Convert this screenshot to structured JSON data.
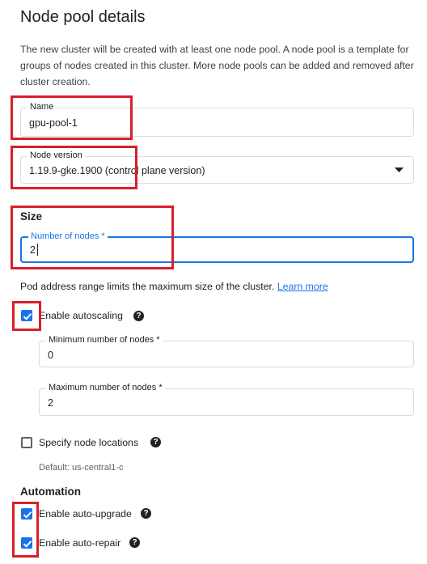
{
  "title": "Node pool details",
  "description": "The new cluster will be created with at least one node pool. A node pool is a template for groups of nodes created in this cluster. More node pools can be added and removed after cluster creation.",
  "name_field": {
    "label": "Name",
    "value": "gpu-pool-1"
  },
  "node_version": {
    "label": "Node version",
    "value": "1.19.9-gke.1900 (control plane version)"
  },
  "size": {
    "heading": "Size",
    "nodes_label": "Number of nodes *",
    "nodes_value": "2",
    "pod_text": "Pod address range limits the maximum size of the cluster.",
    "learn_more": "Learn more"
  },
  "autoscaling": {
    "label": "Enable autoscaling",
    "checked": true,
    "min_label": "Minimum number of nodes *",
    "min_value": "0",
    "max_label": "Maximum number of nodes *",
    "max_value": "2"
  },
  "locations": {
    "label": "Specify node locations",
    "checked": false,
    "default_text": "Default: us-central1-c"
  },
  "automation": {
    "heading": "Automation",
    "upgrade_label": "Enable auto-upgrade",
    "upgrade_checked": true,
    "repair_label": "Enable auto-repair",
    "repair_checked": true
  },
  "help_glyph": "?",
  "accent_color": "#1a73e8",
  "highlight_color": "#d7202b"
}
